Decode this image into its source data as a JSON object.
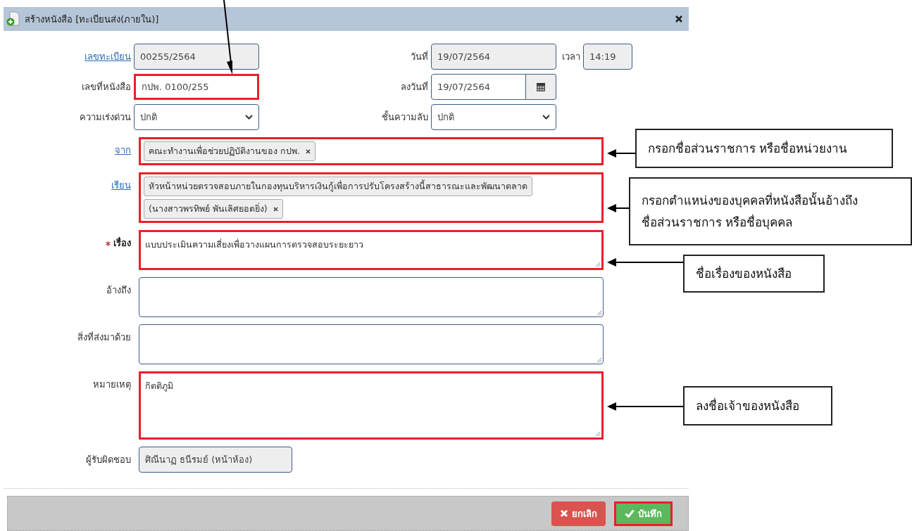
{
  "dialog": {
    "title": "สร้างหนังสือ [ทะเบียนส่ง(ภายใน)]"
  },
  "header_rows": [
    [
      {
        "label": "เลขทะเบียน",
        "label_link": true,
        "kind": "text",
        "value": "00255/2564",
        "readonly": true,
        "highlighted": false
      },
      {
        "label": "วันที่",
        "label_link": false,
        "kind": "text",
        "value": "19/07/2564",
        "readonly": true,
        "highlighted": false
      },
      {
        "label": "เวลา",
        "label_link": false,
        "kind": "text",
        "value": "14:19",
        "readonly": true,
        "highlighted": false
      }
    ],
    [
      {
        "label": "เลขที่หนังสือ",
        "label_link": false,
        "kind": "text",
        "value": "กปพ. 0100/255",
        "readonly": false,
        "highlighted": true
      },
      {
        "label": "ลงวันที่",
        "label_link": false,
        "kind": "date",
        "value": "19/07/2564",
        "readonly": false,
        "highlighted": false
      }
    ],
    [
      {
        "label": "ความเร่งด่วน",
        "label_link": false,
        "kind": "select",
        "value": "ปกติ",
        "readonly": false,
        "highlighted": false
      },
      {
        "label": "ชั้นความลับ",
        "label_link": false,
        "kind": "select",
        "value": "ปกติ",
        "readonly": false,
        "highlighted": false
      }
    ]
  ],
  "body_fields": [
    {
      "label": "จาก",
      "label_link": true,
      "required": false,
      "kind": "tags",
      "tags": [
        "คณะทำงานเพื่อช่วยปฏิบัติงานของ กปพ."
      ],
      "highlighted": true
    },
    {
      "label": "เรียน",
      "label_link": true,
      "required": false,
      "kind": "tags",
      "tags": [
        "หัวหน้าหน่วยตรวจสอบภายในกองทุนบริหารเงินกู้เพื่อการปรับโครงสร้างนี้สาธารณะและพัฒนาตลาด",
        "(นางสาวพรทิพย์ พันเลิศยอดยิ่ง)"
      ],
      "highlighted": true
    },
    {
      "label": "เรื่อง",
      "label_link": false,
      "required": true,
      "kind": "textarea",
      "value": "แบบประเมินความเสี่ยงเพื่อวางแผนการตรวจสอบระยะยาว",
      "highlighted": true
    },
    {
      "label": "อ้างถึง",
      "label_link": false,
      "required": false,
      "kind": "textarea",
      "highlighted": false
    },
    {
      "label": "สิ่งที่ส่งมาด้วย",
      "label_link": false,
      "required": false,
      "kind": "textarea",
      "highlighted": false
    },
    {
      "label": "หมายเหตุ",
      "label_link": false,
      "required": false,
      "kind": "textarea-tall",
      "value": "กิตติภูมิ",
      "highlighted": true
    },
    {
      "label": "ผู้รับผิดชอบ",
      "label_link": false,
      "required": false,
      "kind": "text-short",
      "value": "ศิณีนาฏ ธนีรมย์ (หน้าห้อง)",
      "readonly": true,
      "highlighted": false
    }
  ],
  "buttons": [
    {
      "label": "ยกเลิก",
      "kind": "cancel",
      "highlighted": false
    },
    {
      "label": "บันทึก",
      "kind": "save",
      "highlighted": true
    }
  ],
  "annotations": [
    {
      "lines": [
        "กรอกชื่อส่วนราชการ หรือชื่อหน่วยงาน"
      ]
    },
    {
      "lines": [
        "กรอกตำแหน่งของบุคคลที่หนังสือนั้นอ้างถึง",
        "ชื่อส่วนราชการ หรือชื่อบุคคล"
      ]
    },
    {
      "lines": [
        "ชื่อเรื่องของหนังสือ"
      ]
    },
    {
      "lines": [
        "ลงชื่อเจ้าของหนังสือ"
      ]
    }
  ]
}
